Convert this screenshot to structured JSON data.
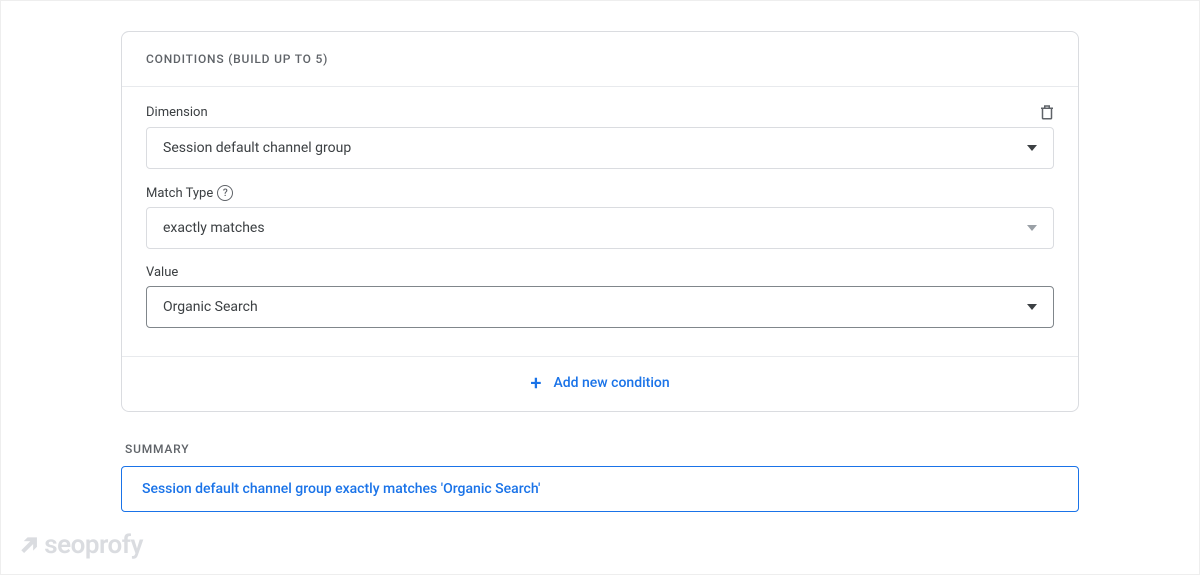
{
  "header": "CONDITIONS (BUILD UP TO 5)",
  "fields": {
    "dimension": {
      "label": "Dimension",
      "value": "Session default channel group"
    },
    "matchType": {
      "label": "Match Type",
      "value": "exactly matches"
    },
    "value": {
      "label": "Value",
      "value": "Organic Search"
    }
  },
  "addButton": "Add new condition",
  "summary": {
    "label": "SUMMARY",
    "text": "Session default channel group exactly matches 'Organic Search'"
  },
  "watermark": "seoprofy"
}
